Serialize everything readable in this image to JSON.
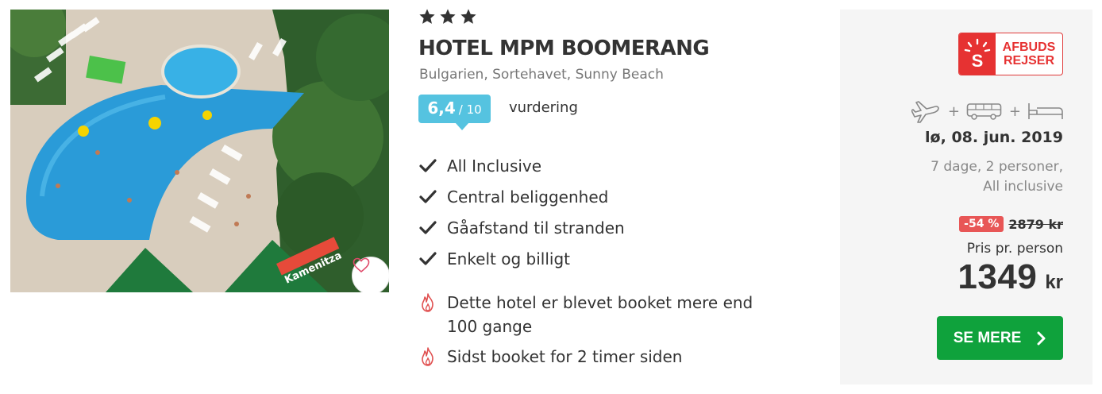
{
  "hotel": {
    "star_count": 3,
    "name": "HOTEL MPM BOOMERANG",
    "location": "Bulgarien, Sortehavet, Sunny Beach",
    "rating": {
      "score": "6,4",
      "scale": "/ 10",
      "label": "vurdering"
    },
    "features": [
      "All Inclusive",
      "Central beliggenhed",
      "Gåafstand til stranden",
      "Enkelt og billigt"
    ],
    "notes": [
      "Dette hotel er blevet booket mere end 100 gange",
      "Sidst booket for 2 timer siden"
    ]
  },
  "photo": {
    "banner_text": "Kamenitza"
  },
  "offer": {
    "brand_line1": "AFBUDS",
    "brand_line2": "REJSER",
    "brand_mark": "S",
    "package_icons": [
      "plane-icon",
      "bus-icon",
      "bed-icon"
    ],
    "plus": "+",
    "date": "lø, 08. jun. 2019",
    "duration": "7 dage, 2 personer,",
    "board": "All inclusive",
    "discount": "-54 %",
    "old_price": "2879 kr",
    "price_label": "Pris pr. person",
    "price": "1349",
    "currency": "kr",
    "cta_label": "SE MERE"
  },
  "colors": {
    "rating_bg": "#55c3e0",
    "brand_red": "#e63232",
    "discount_red": "#e85656",
    "cta_green": "#0fa23c",
    "flame_red": "#e05050"
  }
}
